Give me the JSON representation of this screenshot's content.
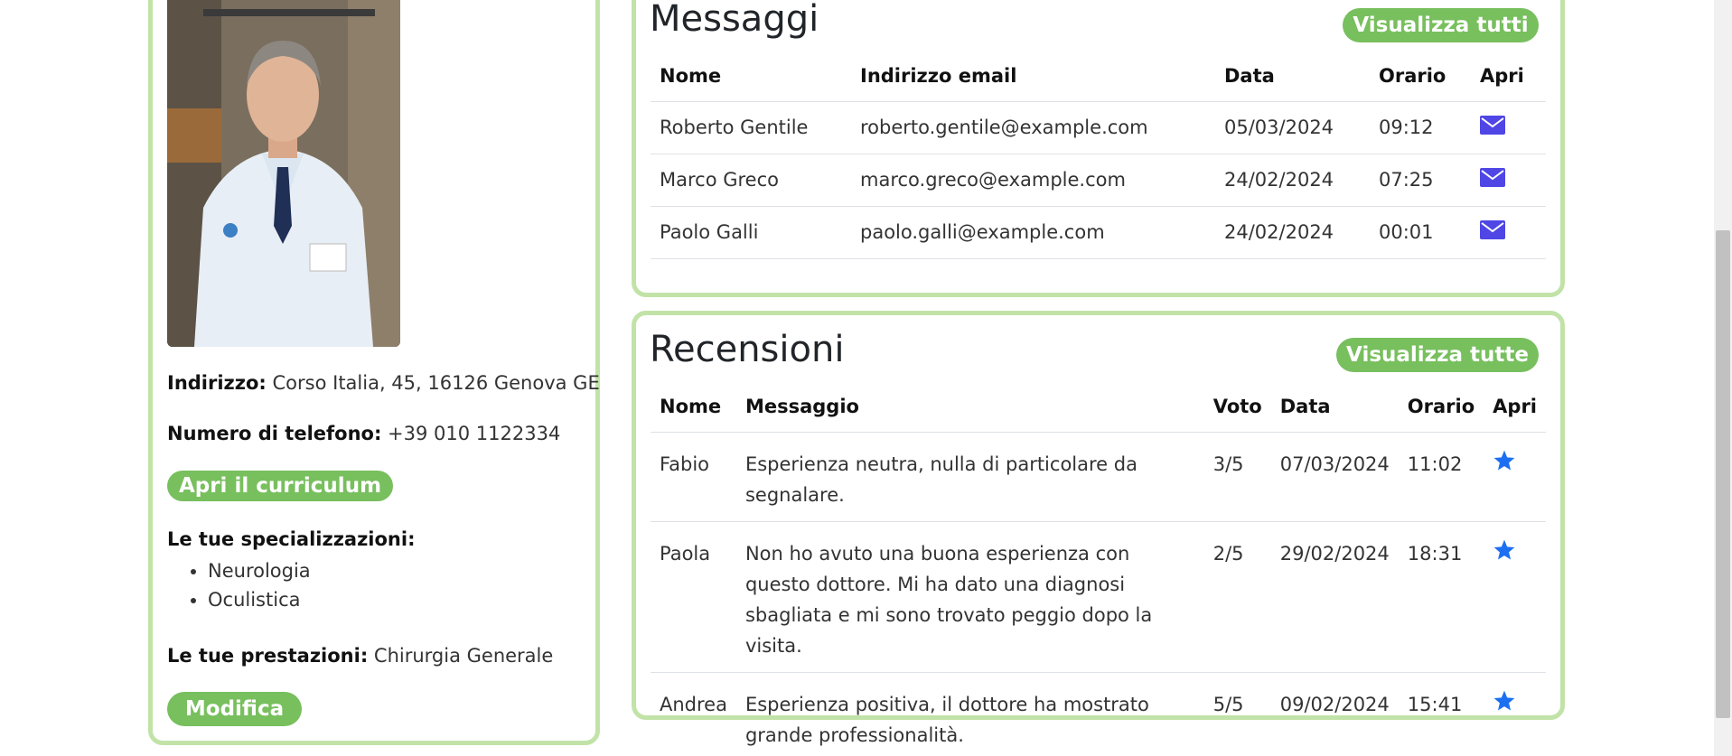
{
  "profile": {
    "address_label": "Indirizzo:",
    "address_value": "Corso Italia, 45, 16126 Genova GE",
    "phone_label": "Numero di telefono:",
    "phone_value": "+39 010 1122334",
    "cv_button": "Apri il curriculum",
    "specializations_label": "Le tue specializzazioni:",
    "specializations": [
      "Neurologia",
      "Oculistica"
    ],
    "services_label": "Le tue prestazioni:",
    "services_value": "Chirurgia Generale",
    "edit_button": "Modifica"
  },
  "messages": {
    "title": "Messaggi",
    "view_all": "Visualizza tutti",
    "columns": [
      "Nome",
      "Indirizzo email",
      "Data",
      "Orario",
      "Apri"
    ],
    "rows": [
      {
        "name": "Roberto Gentile",
        "email": "roberto.gentile@example.com",
        "date": "05/03/2024",
        "time": "09:12",
        "icon": "envelope-icon"
      },
      {
        "name": "Marco Greco",
        "email": "marco.greco@example.com",
        "date": "24/02/2024",
        "time": "07:25",
        "icon": "envelope-icon"
      },
      {
        "name": "Paolo Galli",
        "email": "paolo.galli@example.com",
        "date": "24/02/2024",
        "time": "00:01",
        "icon": "envelope-icon"
      }
    ]
  },
  "reviews": {
    "title": "Recensioni",
    "view_all": "Visualizza tutte",
    "columns": [
      "Nome",
      "Messaggio",
      "Voto",
      "Data",
      "Orario",
      "Apri"
    ],
    "rows": [
      {
        "name": "Fabio",
        "message": "Esperienza neutra, nulla di particolare da segnalare.",
        "score": "3/5",
        "date": "07/03/2024",
        "time": "11:02",
        "icon": "star-icon"
      },
      {
        "name": "Paola",
        "message": "Non ho avuto una buona esperienza con questo dottore. Mi ha dato una diagnosi sbagliata e mi sono trovato peggio dopo la visita.",
        "score": "2/5",
        "date": "29/02/2024",
        "time": "18:31",
        "icon": "star-icon"
      },
      {
        "name": "Andrea",
        "message": "Esperienza positiva, il dottore ha mostrato grande professionalità.",
        "score": "5/5",
        "date": "09/02/2024",
        "time": "15:41",
        "icon": "star-icon"
      }
    ]
  },
  "colors": {
    "accent_green": "#78bf5e",
    "card_border": "#c2e3a8",
    "envelope_blue": "#4f46e5",
    "star_blue": "#1d6ff2"
  }
}
